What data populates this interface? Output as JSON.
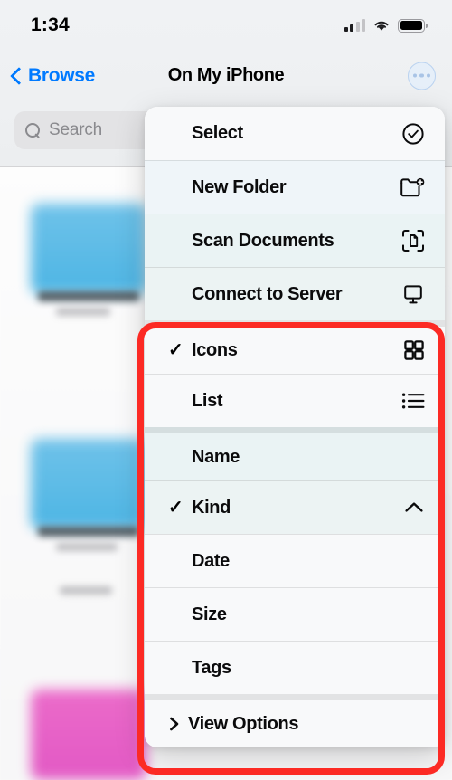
{
  "status_bar": {
    "time": "1:34",
    "signal_icon": "cellular-signal-icon",
    "signal_bars_total": 4,
    "signal_bars_active": 2,
    "wifi_icon": "wifi-icon",
    "battery_icon": "battery-full-icon"
  },
  "nav_bar": {
    "back_label": "Browse",
    "back_icon": "chevron-left-icon",
    "title": "On My iPhone",
    "more_button_icon": "ellipsis-circle-icon"
  },
  "search": {
    "placeholder": "Search",
    "value": "",
    "icon": "search-icon"
  },
  "context_menu": {
    "groups": [
      {
        "id": "actions",
        "items": [
          {
            "label": "Select",
            "icon": "checkmark-circle-icon",
            "checked": false
          },
          {
            "label": "New Folder",
            "icon": "folder-badge-plus-icon",
            "checked": false
          },
          {
            "label": "Scan Documents",
            "icon": "doc-viewfinder-icon",
            "checked": false
          },
          {
            "label": "Connect to Server",
            "icon": "display-icon",
            "checked": false
          }
        ]
      },
      {
        "id": "view-style",
        "items": [
          {
            "label": "Icons",
            "icon": "square-grid-2x2-icon",
            "checked": true
          },
          {
            "label": "List",
            "icon": "list-bullet-icon",
            "checked": false
          }
        ]
      },
      {
        "id": "sort-by",
        "items": [
          {
            "label": "Name",
            "icon": "",
            "checked": false
          },
          {
            "label": "Kind",
            "icon": "chevron-up-icon",
            "checked": true
          },
          {
            "label": "Date",
            "icon": "",
            "checked": false
          },
          {
            "label": "Size",
            "icon": "",
            "checked": false
          },
          {
            "label": "Tags",
            "icon": "",
            "checked": false
          }
        ]
      },
      {
        "id": "view-options",
        "items": [
          {
            "label": "View Options",
            "icon": "",
            "checked": false,
            "leading_icon": "chevron-right-icon"
          }
        ]
      }
    ]
  },
  "highlight": {
    "color": "#fc2a24",
    "label": "red-highlight-box"
  },
  "background_files": {
    "folder_color_blue": "#3fb0e3",
    "folder_color_pink": "#e14cc0"
  }
}
